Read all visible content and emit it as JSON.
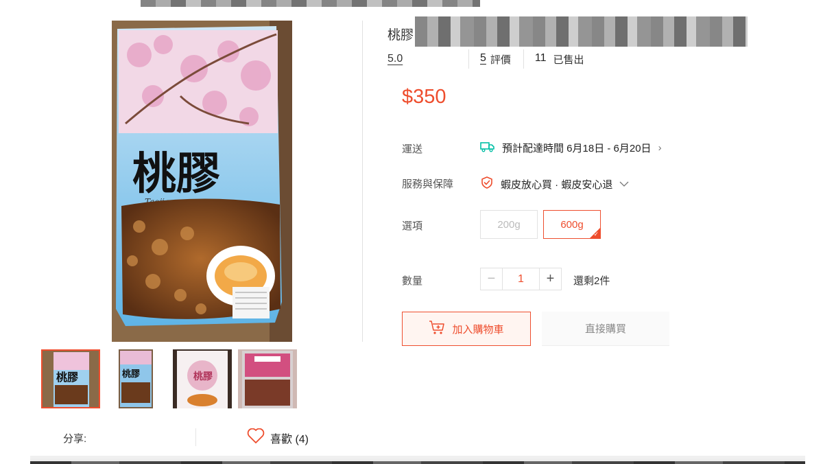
{
  "product": {
    "title_visible": "桃膠",
    "rating_score": "5.0",
    "reviews_count": "5",
    "reviews_label": "評價",
    "sold_count": "11",
    "sold_label": "已售出",
    "price": "$350"
  },
  "package_art": {
    "brand_text": "桃膠",
    "brand_sub": "Taojiao"
  },
  "gallery": {
    "thumbnails": [
      {
        "name": "thumb-1",
        "active": true
      },
      {
        "name": "thumb-2",
        "active": false
      },
      {
        "name": "thumb-3",
        "active": false
      },
      {
        "name": "thumb-4",
        "active": false
      }
    ]
  },
  "shipping": {
    "label": "運送",
    "text": "預計配達時間 6月18日 - 6月20日",
    "icon": "truck-icon"
  },
  "service": {
    "label": "服務與保障",
    "text": "蝦皮放心買 · 蝦皮安心退",
    "icon": "shield-icon"
  },
  "options": {
    "label": "選項",
    "items": [
      {
        "label": "200g",
        "state": "disabled"
      },
      {
        "label": "600g",
        "state": "selected"
      }
    ]
  },
  "quantity": {
    "label": "數量",
    "value": "1",
    "minus": "−",
    "plus": "+",
    "stock_text": "還剩2件"
  },
  "actions": {
    "add_to_cart": "加入購物車",
    "buy_now": "直接購買"
  },
  "social": {
    "share_label": "分享:",
    "like_label": "喜歡 (4)"
  },
  "colors": {
    "accent": "#ee4d2d",
    "shipping_icon": "#00bfa5"
  }
}
